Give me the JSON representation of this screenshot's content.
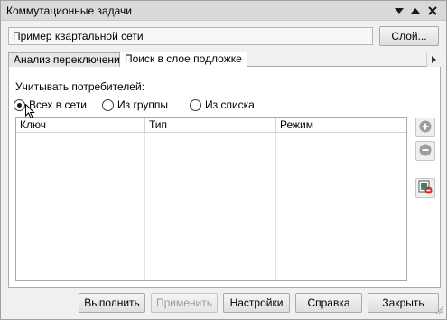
{
  "window": {
    "title": "Коммутационные задачи",
    "title_icons": [
      "dropdown-icon",
      "pin-icon",
      "close-icon"
    ]
  },
  "network": {
    "name_value": "Пример квартальной сети",
    "layer_button_label": "Слой..."
  },
  "tabs": [
    {
      "label": "Анализ переключений",
      "active": false
    },
    {
      "label": "Поиск в слое подложке",
      "active": true
    }
  ],
  "consumers": {
    "label": "Учитывать потребителей:",
    "options": [
      {
        "label": "Всех в сети",
        "checked": true
      },
      {
        "label": "Из группы",
        "checked": false
      },
      {
        "label": "Из списка",
        "checked": false
      }
    ]
  },
  "table": {
    "columns": [
      "Ключ",
      "Тип",
      "Режим"
    ],
    "rows": []
  },
  "side_buttons": [
    "add-icon",
    "remove-icon",
    "layer-delete-icon"
  ],
  "footer": {
    "execute": "Выполнить",
    "apply": "Применить",
    "settings": "Настройки",
    "help": "Справка",
    "close": "Закрыть"
  }
}
